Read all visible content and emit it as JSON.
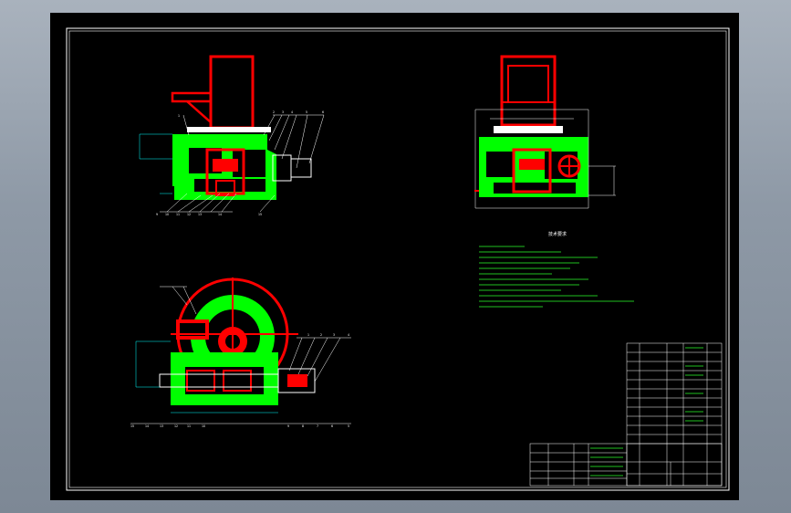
{
  "canvas": {
    "background": "#000000",
    "border_color": "#ffffff",
    "colors": {
      "red": "#ff0000",
      "green": "#00ff00",
      "white": "#ffffff",
      "cyan": "#00ffff",
      "yellow": "#ffff00"
    }
  },
  "views": {
    "front": {
      "balloons_top": [
        "1",
        "2",
        "3",
        "4",
        "5",
        "6"
      ],
      "balloons_bottom": [
        "9",
        "10",
        "11",
        "12",
        "13",
        "14",
        "15"
      ]
    },
    "bottom": {
      "balloons_top": [
        "1",
        "2",
        "3",
        "4"
      ],
      "balloons_bottom": [
        "15",
        "14",
        "13",
        "12",
        "11",
        "10",
        "9",
        "8",
        "7",
        "6",
        "5"
      ]
    }
  },
  "notes": {
    "title": "技术要求"
  },
  "title_block": {
    "icon": "cad-title-block"
  }
}
